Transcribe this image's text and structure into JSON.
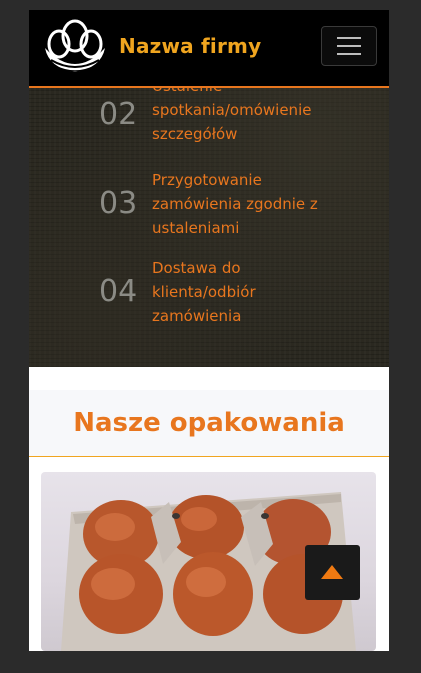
{
  "navbar": {
    "brand": "Nazwa firmy"
  },
  "process": {
    "steps": [
      {
        "num": "02",
        "text": "Ustalenie spotkania/omówienie szczegółów"
      },
      {
        "num": "03",
        "text": "Przygotowanie zamówienia zgodnie z ustaleniami"
      },
      {
        "num": "04",
        "text": "Dostawa do klienta/odbiór zamówienia"
      }
    ]
  },
  "packaging": {
    "title": "Nasze opakowania"
  },
  "colors": {
    "accent": "#e8761e",
    "brand": "#f0a51f",
    "navbar_bg": "#000000"
  },
  "icons": {
    "logo": "egg-nest-logo",
    "menu": "hamburger-icon",
    "scroll_top": "caret-up-icon"
  }
}
